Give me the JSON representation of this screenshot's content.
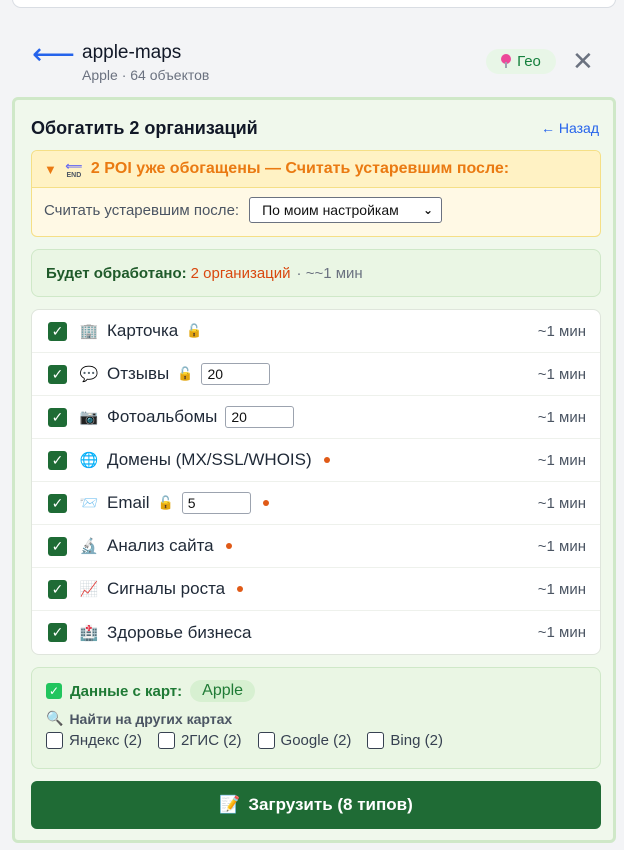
{
  "header": {
    "back_glyph": "⟵",
    "title": "apple-maps",
    "subtitle": "Apple · 64 объектов",
    "geo_label": "Гео",
    "close_glyph": "✕"
  },
  "panel": {
    "title": "Обогатить 2 организаций",
    "back_link": "← Назад"
  },
  "warning": {
    "headline": "2 POI уже обогащены — Считать устаревшим после:",
    "body_label": "Считать устаревшим после:",
    "select_value": "По моим настройкам"
  },
  "summary": {
    "label": "Будет обработано:",
    "count": "2 организаций",
    "eta": "· ~~1 мин"
  },
  "items": [
    {
      "icon": "building-icon",
      "glyph": "🏢",
      "label": "Карточка",
      "lock": true,
      "input": null,
      "dot": false,
      "time": "~1 мин",
      "checked": true
    },
    {
      "icon": "speech-bubble-icon",
      "glyph": "💬",
      "label": "Отзывы",
      "lock": true,
      "input": "20",
      "dot": false,
      "time": "~1 мин",
      "checked": true
    },
    {
      "icon": "camera-icon",
      "glyph": "📷",
      "label": "Фотоальбомы",
      "lock": false,
      "input": "20",
      "dot": false,
      "time": "~1 мин",
      "checked": true
    },
    {
      "icon": "globe-icon",
      "glyph": "🌐",
      "label": "Домены (MX/SSL/WHOIS)",
      "lock": false,
      "input": null,
      "dot": true,
      "time": "~1 мин",
      "checked": true
    },
    {
      "icon": "email-icon",
      "glyph": "📨",
      "label": "Email",
      "lock": true,
      "input": "5",
      "dot": true,
      "time": "~1 мин",
      "checked": true
    },
    {
      "icon": "microscope-icon",
      "glyph": "🔬",
      "label": "Анализ сайта",
      "lock": false,
      "input": null,
      "dot": true,
      "time": "~1 мин",
      "checked": true
    },
    {
      "icon": "chart-up-icon",
      "glyph": "📈",
      "label": "Сигналы роста",
      "lock": false,
      "input": null,
      "dot": true,
      "time": "~1 мин",
      "checked": true
    },
    {
      "icon": "health-icon",
      "glyph": "🏥",
      "label": "Здоровье бизнеса",
      "lock": false,
      "input": null,
      "dot": false,
      "time": "~1 мин",
      "checked": true
    }
  ],
  "maps": {
    "label": "Данные с карт:",
    "source": "Apple",
    "find_label": "Найти на других картах",
    "others": [
      {
        "label": "Яндекс (2)",
        "checked": false
      },
      {
        "label": "2ГИС (2)",
        "checked": false
      },
      {
        "label": "Google (2)",
        "checked": false
      },
      {
        "label": "Bing (2)",
        "checked": false
      }
    ]
  },
  "load_button": {
    "icon": "📝",
    "label": "Загрузить (8 типов)"
  },
  "colors": {
    "accent_green": "#1f6b35",
    "warning_orange": "#ea7a12",
    "link_blue": "#2563eb"
  }
}
